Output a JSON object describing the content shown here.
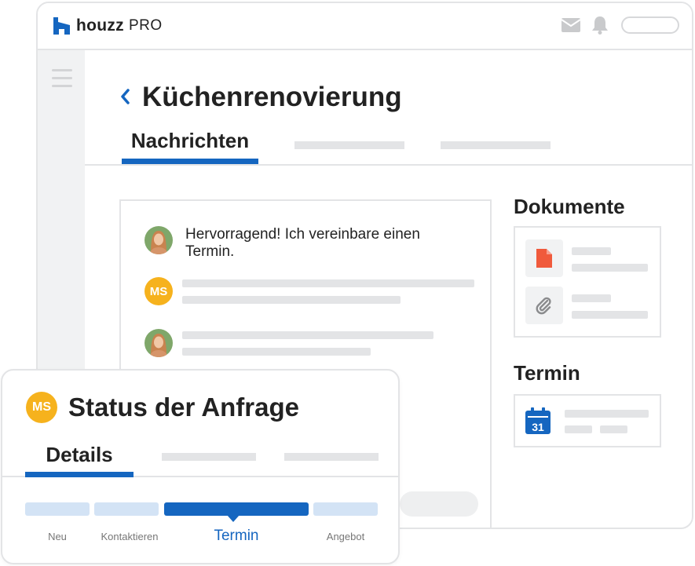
{
  "app": {
    "brand": "houzz",
    "brand_suffix": "PRO"
  },
  "project": {
    "title": "Küchenrenovierung",
    "active_tab": "Nachrichten"
  },
  "messages": [
    {
      "avatar": "photo",
      "text": "Hervorragend! Ich vereinbare einen Termin."
    },
    {
      "avatar": "initials",
      "initials": "MS"
    },
    {
      "avatar": "photo"
    }
  ],
  "side": {
    "documents_title": "Dokumente",
    "documents": [
      {
        "icon": "pdf-file-icon",
        "color": "#f05a3c"
      },
      {
        "icon": "paperclip-icon",
        "color": "#8a8b8d"
      }
    ],
    "appointment_title": "Termin",
    "calendar_day": "31"
  },
  "status": {
    "initials": "MS",
    "title": "Status der Anfrage",
    "active_tab": "Details",
    "stages": [
      "Neu",
      "Kontaktieren",
      "Termin",
      "Angebot"
    ],
    "current_stage": "Termin"
  },
  "colors": {
    "accent": "#1566c0",
    "avatar_yellow": "#f6b21d",
    "stage_inactive": "#d3e3f5"
  }
}
